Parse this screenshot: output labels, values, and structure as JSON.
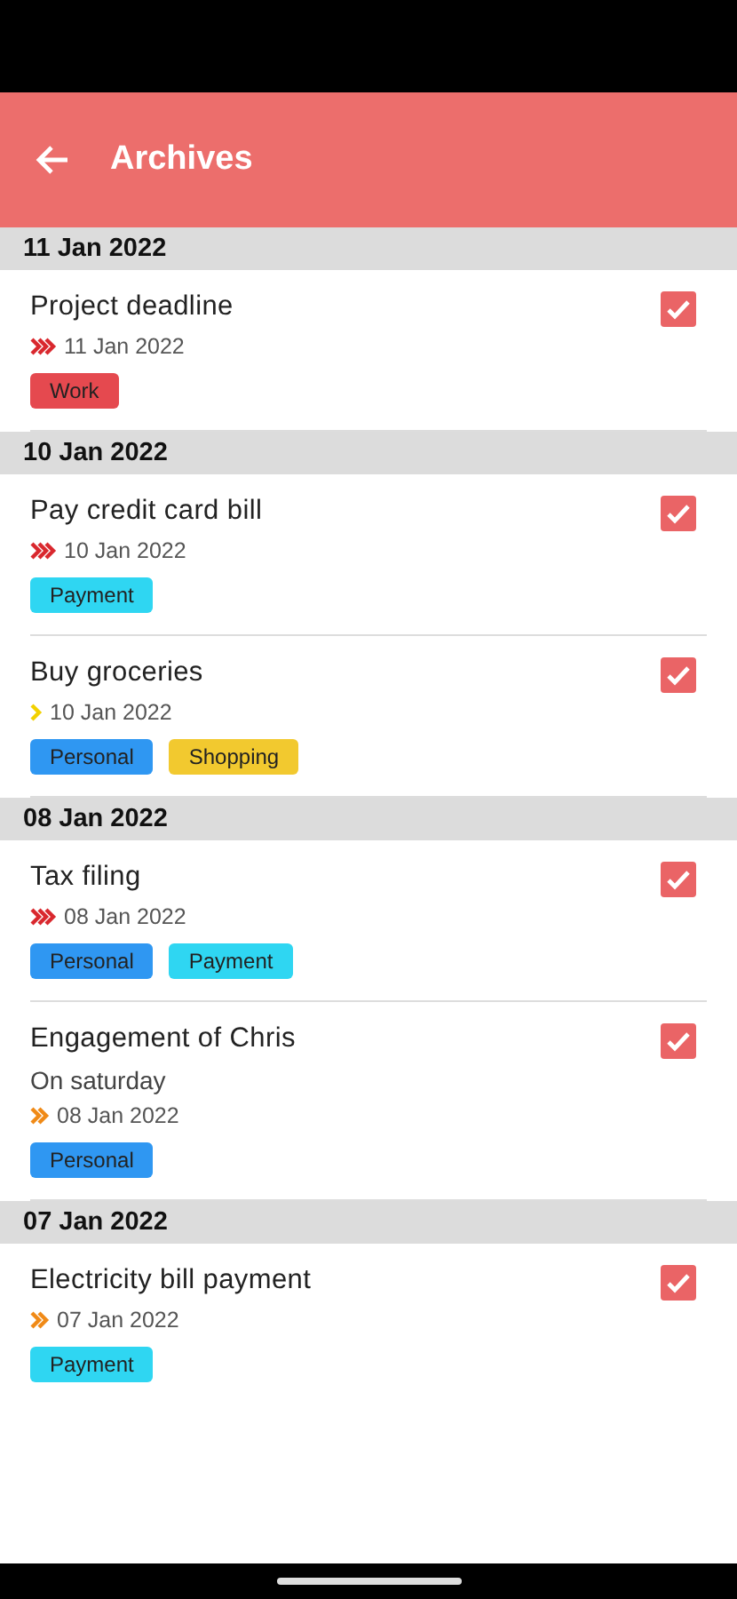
{
  "header": {
    "title": "Archives"
  },
  "groups": [
    {
      "date": "11 Jan 2022",
      "tasks": [
        {
          "title": "Project deadline",
          "kind": "high",
          "date": "11 Jan 2022",
          "checked": true,
          "tags": [
            {
              "label": "Work",
              "color": "#e5494f"
            }
          ]
        }
      ]
    },
    {
      "date": "10 Jan 2022",
      "tasks": [
        {
          "title": "Pay credit card bill",
          "kind": "high",
          "date": "10 Jan 2022",
          "checked": true,
          "tags": [
            {
              "label": "Payment",
              "color": "#2fd6f2"
            }
          ]
        },
        {
          "title": "Buy groceries",
          "kind": "low",
          "date": "10 Jan 2022",
          "checked": true,
          "tags": [
            {
              "label": "Personal",
              "color": "#2f97f2"
            },
            {
              "label": "Shopping",
              "color": "#f2c92f"
            }
          ]
        }
      ]
    },
    {
      "date": "08 Jan 2022",
      "tasks": [
        {
          "title": "Tax filing",
          "kind": "high",
          "date": "08 Jan 2022",
          "checked": true,
          "tags": [
            {
              "label": "Personal",
              "color": "#2f97f2"
            },
            {
              "label": "Payment",
              "color": "#2fd6f2"
            }
          ]
        },
        {
          "title": "Engagement of Chris",
          "note": "On saturday",
          "kind": "medium",
          "date": "08 Jan 2022",
          "checked": true,
          "tags": [
            {
              "label": "Personal",
              "color": "#2f97f2"
            }
          ]
        }
      ]
    },
    {
      "date": "07 Jan 2022",
      "tasks": [
        {
          "title": "Electricity bill payment",
          "kind": "medium",
          "date": "07 Jan 2022",
          "checked": true,
          "tags": [
            {
              "label": "Payment",
              "color": "#2fd6f2"
            }
          ]
        }
      ]
    }
  ]
}
